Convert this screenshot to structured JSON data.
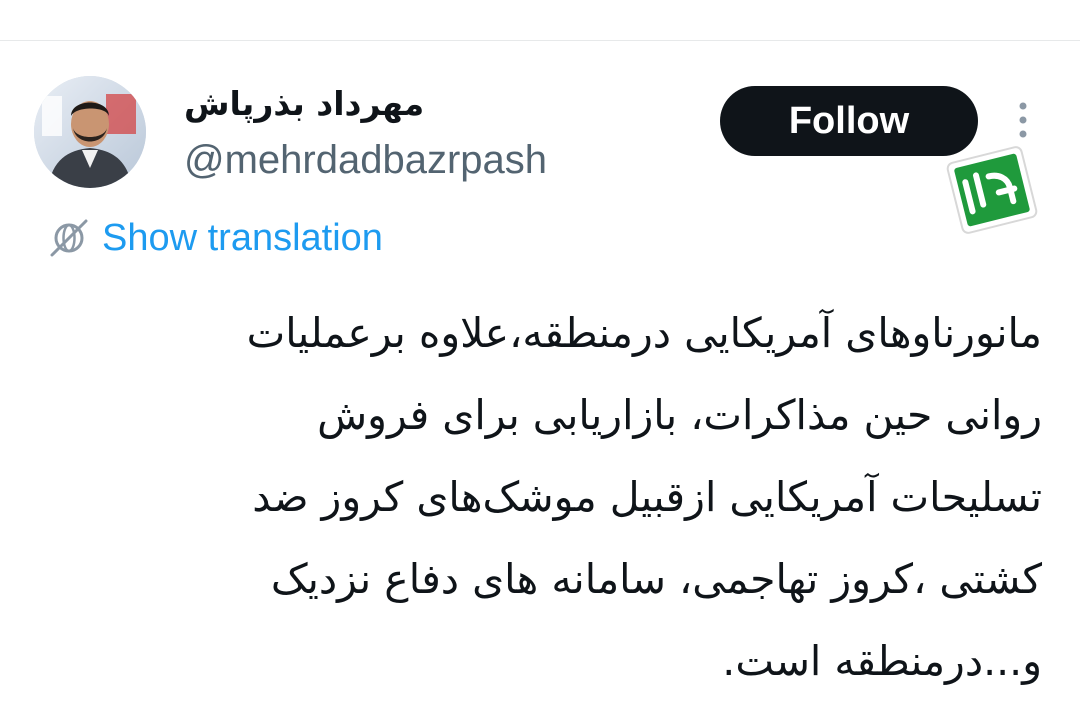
{
  "tweet": {
    "author": {
      "display_name": "مهرداد بذرپاش",
      "handle": "@mehrdadbazrpash",
      "avatar_icon": "user-avatar-photo"
    },
    "follow_label": "Follow",
    "more_icon": "more-vertical-icon",
    "watermark": {
      "text": "رجا",
      "color": "#1f9a3c"
    },
    "show_translation": {
      "label": "Show translation",
      "icon": "translate-globe-icon",
      "color": "#1d9bf0"
    },
    "text_lines": [
      "مانورناوهای آمریکایی درمنطقه،علاوه برعملیات",
      "روانی حین مذاکرات، بازاریابی برای فروش",
      "تسلیحات آمریکایی ازقبیل موشک‌های کروز ضد",
      "کشتی ،کروز تهاجمی، سامانه های دفاع نزدیک",
      "و...درمنطقه است."
    ]
  },
  "colors": {
    "text_primary": "#0f1419",
    "text_secondary": "#536471",
    "accent_blue": "#1d9bf0",
    "button_bg": "#0f1419",
    "divider": "#e7e9ea"
  }
}
